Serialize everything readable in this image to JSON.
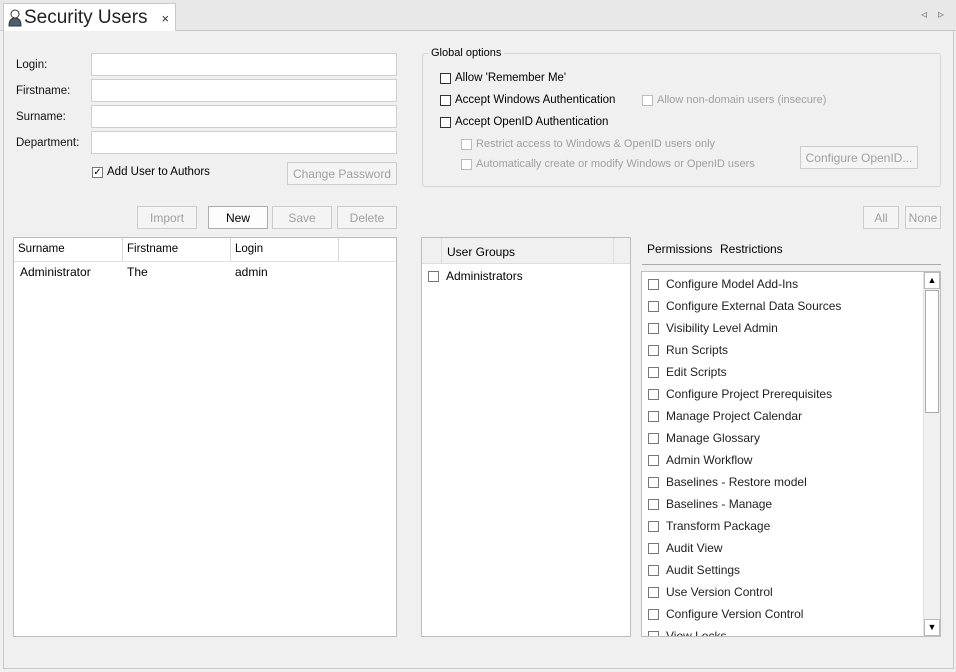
{
  "tab": {
    "title": "Security Users",
    "close": "×",
    "icon": "user-icon"
  },
  "nav": {
    "prev": "◃",
    "next": "▹"
  },
  "form": {
    "login_label": "Login:",
    "firstname_label": "Firstname:",
    "surname_label": "Surname:",
    "department_label": "Department:",
    "login": "",
    "firstname": "",
    "surname": "",
    "department": "",
    "add_to_authors": "Add User to Authors",
    "add_to_authors_checked": true,
    "change_password": "Change Password"
  },
  "actions": {
    "import": "Import",
    "new": "New",
    "save": "Save",
    "delete": "Delete"
  },
  "global": {
    "legend": "Global options",
    "remember_me": "Allow 'Remember Me'",
    "windows_auth": "Accept Windows Authentication",
    "non_domain": "Allow non-domain users (insecure)",
    "openid_auth": "Accept OpenID Authentication",
    "restrict": "Restrict access to Windows & OpenID users only",
    "auto_create": "Automatically create or modify Windows or OpenID users",
    "configure_openid": "Configure OpenID..."
  },
  "users": {
    "columns": [
      "Surname",
      "Firstname",
      "Login"
    ],
    "rows": [
      [
        "Administrator",
        "The",
        "admin"
      ]
    ]
  },
  "groups": {
    "header": "User Groups",
    "items": [
      "Administrators"
    ]
  },
  "perm_buttons": {
    "all": "All",
    "none": "None"
  },
  "perm_tabs": [
    "Permissions",
    "Restrictions"
  ],
  "permissions": [
    "Configure Model Add-Ins",
    "Configure External Data Sources",
    "Visibility Level Admin",
    "Run Scripts",
    "Edit Scripts",
    "Configure Project Prerequisites",
    "Manage Project Calendar",
    "Manage Glossary",
    "Admin Workflow",
    "Baselines - Restore model",
    "Baselines - Manage",
    "Transform Package",
    "Audit View",
    "Audit Settings",
    "Use Version Control",
    "Configure Version Control",
    "View Locks"
  ]
}
